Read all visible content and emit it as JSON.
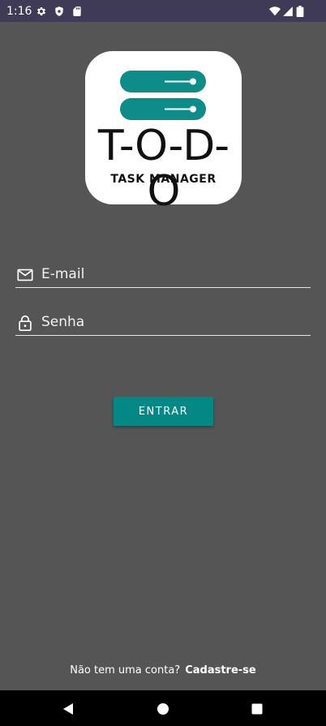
{
  "status_bar": {
    "time": "1:16",
    "left_icons": [
      "settings-icon",
      "shield-icon",
      "sd-card-icon"
    ],
    "right_icons": [
      "wifi-icon",
      "signal-icon",
      "battery-icon"
    ]
  },
  "logo": {
    "title": "T-O-D-O",
    "subtitle": "TASK MANAGER",
    "accent_color": "#0e8c8a"
  },
  "form": {
    "email": {
      "placeholder": "E-mail",
      "value": "",
      "icon": "mail-icon"
    },
    "password": {
      "placeholder": "Senha",
      "value": "",
      "icon": "lock-icon"
    },
    "submit_label": "ENTRAR"
  },
  "signup": {
    "prompt": "Não tem uma conta?",
    "link": "Cadastre-se"
  },
  "nav": {
    "buttons": [
      "back-icon",
      "home-icon",
      "recents-icon"
    ]
  },
  "colors": {
    "background": "#555555",
    "status_bar": "#3f3a55",
    "button": "#048886"
  }
}
